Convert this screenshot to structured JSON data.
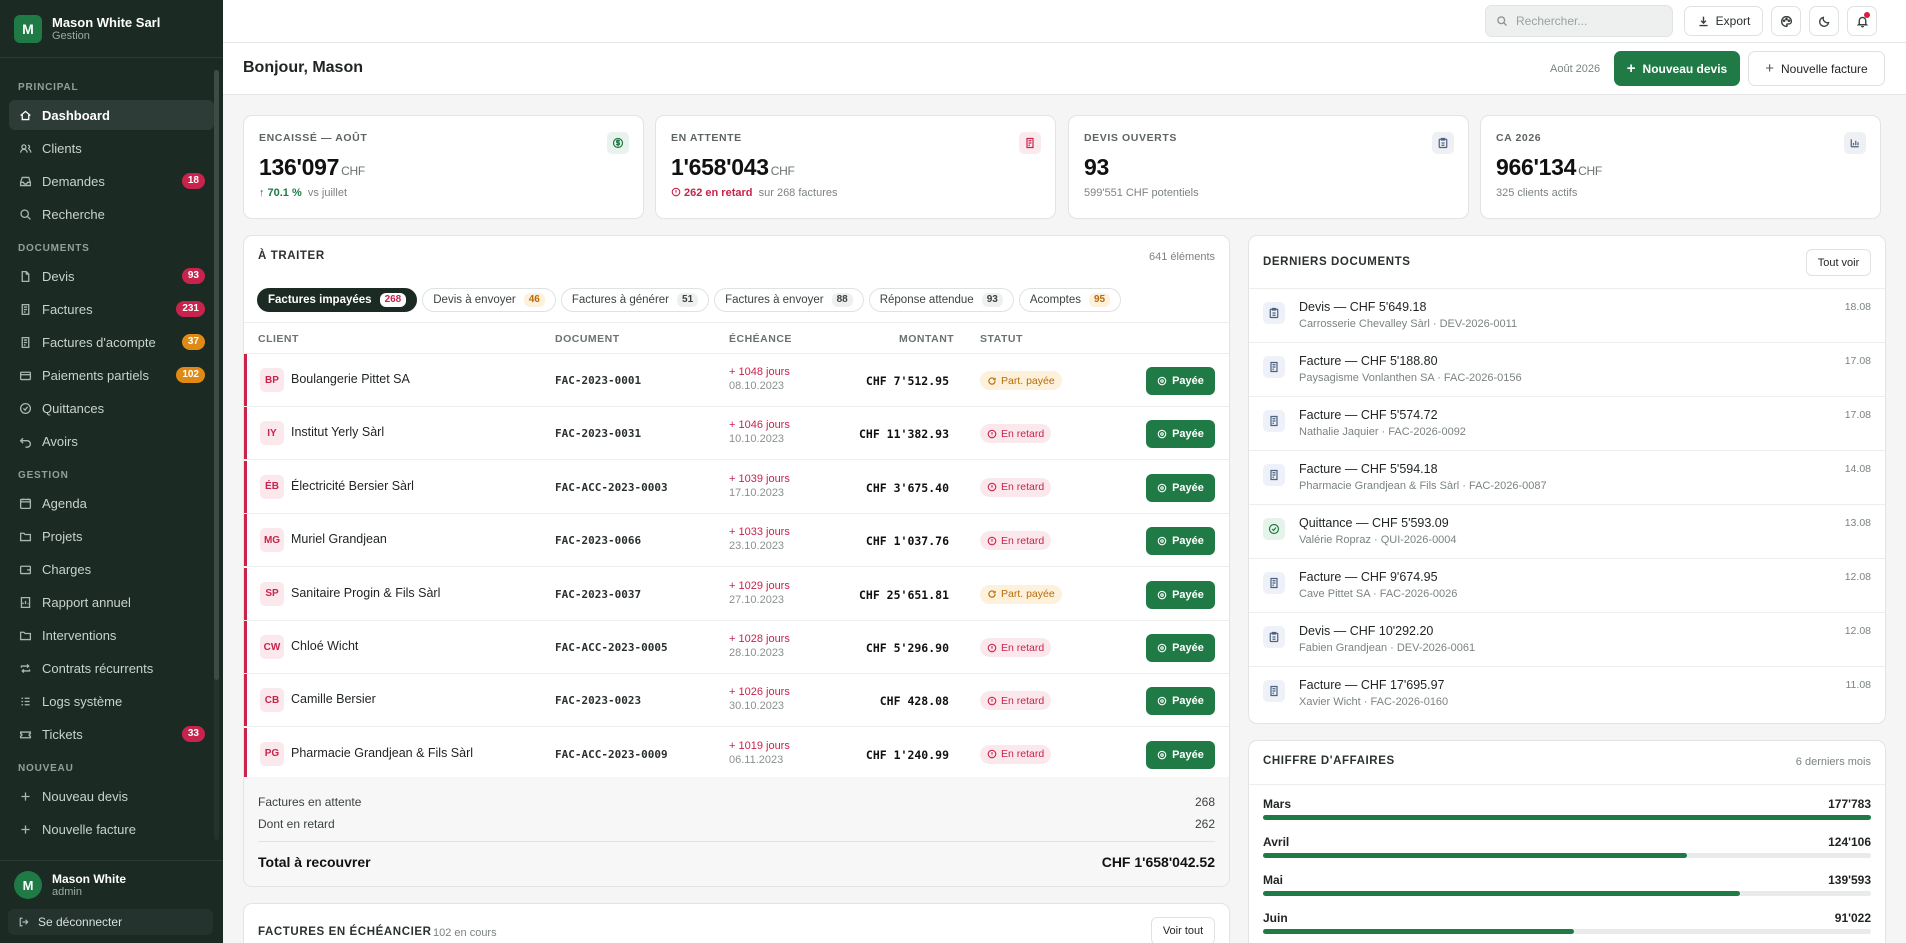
{
  "brand": {
    "name": "Mason White Sarl",
    "subtitle": "Gestion",
    "logo_letter": "M"
  },
  "sidebar": {
    "sections": [
      {
        "title": "PRINCIPAL",
        "items": [
          {
            "label": "Dashboard",
            "icon": "home-icon",
            "active": true
          },
          {
            "label": "Clients",
            "icon": "users-icon"
          },
          {
            "label": "Demandes",
            "icon": "inbox-icon",
            "badge": "18",
            "badge_color": "red"
          },
          {
            "label": "Recherche",
            "icon": "search-icon"
          }
        ]
      },
      {
        "title": "DOCUMENTS",
        "items": [
          {
            "label": "Devis",
            "icon": "file-icon",
            "badge": "93",
            "badge_color": "red"
          },
          {
            "label": "Factures",
            "icon": "invoice-icon",
            "badge": "231",
            "badge_color": "red"
          },
          {
            "label": "Factures d'acompte",
            "icon": "invoice-icon",
            "badge": "37",
            "badge_color": "orange"
          },
          {
            "label": "Paiements partiels",
            "icon": "card-icon",
            "badge": "102",
            "badge_color": "orange"
          },
          {
            "label": "Quittances",
            "icon": "check-circle-icon"
          },
          {
            "label": "Avoirs",
            "icon": "undo-icon"
          }
        ]
      },
      {
        "title": "GESTION",
        "items": [
          {
            "label": "Agenda",
            "icon": "calendar-icon"
          },
          {
            "label": "Projets",
            "icon": "folder-icon"
          },
          {
            "label": "Charges",
            "icon": "wallet-icon"
          },
          {
            "label": "Rapport annuel",
            "icon": "report-icon"
          },
          {
            "label": "Interventions",
            "icon": "folder-icon"
          },
          {
            "label": "Contrats récurrents",
            "icon": "repeat-icon"
          },
          {
            "label": "Logs système",
            "icon": "list-icon"
          },
          {
            "label": "Tickets",
            "icon": "ticket-icon",
            "badge": "33",
            "badge_color": "red"
          }
        ]
      },
      {
        "title": "NOUVEAU",
        "items": [
          {
            "label": "Nouveau devis",
            "icon": "plus-icon"
          },
          {
            "label": "Nouvelle facture",
            "icon": "plus-icon"
          }
        ]
      }
    ]
  },
  "user": {
    "name": "Mason White",
    "role": "admin",
    "initial": "M",
    "logout_label": "Se déconnecter"
  },
  "topbar": {
    "search_placeholder": "Rechercher...",
    "export_label": "Export"
  },
  "header": {
    "greeting": "Bonjour, Mason",
    "date": "Août 2026",
    "new_quote": "Nouveau devis",
    "new_invoice": "Nouvelle facture"
  },
  "stats": [
    {
      "label": "ENCAISSÉ — AOÛT",
      "value": "136'097",
      "unit": "CHF",
      "sub_strong": "70.1 %",
      "sub": "vs juillet",
      "icon": "dollar-icon",
      "color": "#1f7a45"
    },
    {
      "label": "EN ATTENTE",
      "value": "1'658'043",
      "unit": "CHF",
      "sub_strong": "262 en retard",
      "sub": "sur 268 factures",
      "icon": "invoice-icon",
      "color": "#c8234c"
    },
    {
      "label": "DEVIS OUVERTS",
      "value": "93",
      "unit": "",
      "sub_strong": "",
      "sub": "599'551 CHF potentiels",
      "icon": "clipboard-icon",
      "color": "#4b6283"
    },
    {
      "label": "CA 2026",
      "value": "966'134",
      "unit": "CHF",
      "sub_strong": "",
      "sub": "325 clients actifs",
      "icon": "chart-icon",
      "color": "#4b6283"
    }
  ],
  "todo": {
    "title": "À TRAITER",
    "count": "641 éléments",
    "tabs": [
      {
        "label": "Factures impayées",
        "count": "268",
        "active": true
      },
      {
        "label": "Devis à envoyer",
        "count": "46"
      },
      {
        "label": "Factures à générer",
        "count": "51"
      },
      {
        "label": "Factures à envoyer",
        "count": "88"
      },
      {
        "label": "Réponse attendue",
        "count": "93"
      },
      {
        "label": "Acomptes",
        "count": "95"
      }
    ],
    "columns": {
      "client": "CLIENT",
      "document": "DOCUMENT",
      "due": "ÉCHÉANCE",
      "amount": "MONTANT",
      "status": "STATUT"
    },
    "rows": [
      {
        "initials": "BP",
        "client": "Boulangerie Pittet SA",
        "doc": "FAC-2023-0001",
        "days": "+ 1048 jours",
        "date": "08.10.2023",
        "amount": "CHF 7'512.95",
        "status": "Part. payée",
        "status_type": "partial",
        "action": "Payée"
      },
      {
        "initials": "IY",
        "client": "Institut Yerly Sàrl",
        "doc": "FAC-2023-0031",
        "days": "+ 1046 jours",
        "date": "10.10.2023",
        "amount": "CHF 11'382.93",
        "status": "En retard",
        "status_type": "late",
        "action": "Payée"
      },
      {
        "initials": "ÉB",
        "client": "Électricité Bersier Sàrl",
        "doc": "FAC-ACC-2023-0003",
        "days": "+ 1039 jours",
        "date": "17.10.2023",
        "amount": "CHF 3'675.40",
        "status": "En retard",
        "status_type": "late",
        "action": "Payée"
      },
      {
        "initials": "MG",
        "client": "Muriel Grandjean",
        "doc": "FAC-2023-0066",
        "days": "+ 1033 jours",
        "date": "23.10.2023",
        "amount": "CHF 1'037.76",
        "status": "En retard",
        "status_type": "late",
        "action": "Payée"
      },
      {
        "initials": "SP",
        "client": "Sanitaire Progin & Fils Sàrl",
        "doc": "FAC-2023-0037",
        "days": "+ 1029 jours",
        "date": "27.10.2023",
        "amount": "CHF 25'651.81",
        "status": "Part. payée",
        "status_type": "partial",
        "action": "Payée"
      },
      {
        "initials": "CW",
        "client": "Chloé Wicht",
        "doc": "FAC-ACC-2023-0005",
        "days": "+ 1028 jours",
        "date": "28.10.2023",
        "amount": "CHF 5'296.90",
        "status": "En retard",
        "status_type": "late",
        "action": "Payée"
      },
      {
        "initials": "CB",
        "client": "Camille Bersier",
        "doc": "FAC-2023-0023",
        "days": "+ 1026 jours",
        "date": "30.10.2023",
        "amount": "CHF 428.08",
        "status": "En retard",
        "status_type": "late",
        "action": "Payée"
      },
      {
        "initials": "PG",
        "client": "Pharmacie Grandjean & Fils Sàrl",
        "doc": "FAC-ACC-2023-0009",
        "days": "+ 1019 jours",
        "date": "06.11.2023",
        "amount": "CHF 1'240.99",
        "status": "En retard",
        "status_type": "late",
        "action": "Payée"
      }
    ],
    "summary": {
      "pending_label": "Factures en attente",
      "pending_value": "268",
      "late_label": "Dont en retard",
      "late_value": "262",
      "total_label": "Total à recouvrer",
      "total_value": "CHF 1'658'042.52"
    }
  },
  "installments": {
    "title": "FACTURES EN ÉCHÉANCIER",
    "count": "102 en cours",
    "button": "Voir tout"
  },
  "documents": {
    "title": "DERNIERS DOCUMENTS",
    "button": "Tout voir",
    "items": [
      {
        "title": "Devis — CHF 5'649.18",
        "sub": "Carrosserie Chevalley Sàrl · DEV-2026-0011",
        "date": "18.08",
        "icon": "clipboard-icon"
      },
      {
        "title": "Facture — CHF 5'188.80",
        "sub": "Paysagisme Vonlanthen SA · FAC-2026-0156",
        "date": "17.08",
        "icon": "invoice-icon"
      },
      {
        "title": "Facture — CHF 5'574.72",
        "sub": "Nathalie Jaquier · FAC-2026-0092",
        "date": "17.08",
        "icon": "invoice-icon"
      },
      {
        "title": "Facture — CHF 5'594.18",
        "sub": "Pharmacie Grandjean & Fils Sàrl · FAC-2026-0087",
        "date": "14.08",
        "icon": "invoice-icon"
      },
      {
        "title": "Quittance — CHF 5'593.09",
        "sub": "Valérie Ropraz · QUI-2026-0004",
        "date": "13.08",
        "icon": "check-circle-icon"
      },
      {
        "title": "Facture — CHF 9'674.95",
        "sub": "Cave Pittet SA · FAC-2026-0026",
        "date": "12.08",
        "icon": "invoice-icon"
      },
      {
        "title": "Devis — CHF 10'292.20",
        "sub": "Fabien Grandjean · DEV-2026-0061",
        "date": "12.08",
        "icon": "clipboard-icon"
      },
      {
        "title": "Facture — CHF 17'695.97",
        "sub": "Xavier Wicht · FAC-2026-0160",
        "date": "11.08",
        "icon": "invoice-icon"
      }
    ]
  },
  "revenue": {
    "title": "CHIFFRE D'AFFAIRES",
    "period": "6 derniers mois",
    "months": [
      {
        "month": "Mars",
        "value": "177'783",
        "ratio": 1.0
      },
      {
        "month": "Avril",
        "value": "124'106",
        "ratio": 0.698
      },
      {
        "month": "Mai",
        "value": "139'593",
        "ratio": 0.785
      },
      {
        "month": "Juin",
        "value": "91'022",
        "ratio": 0.512
      }
    ]
  }
}
